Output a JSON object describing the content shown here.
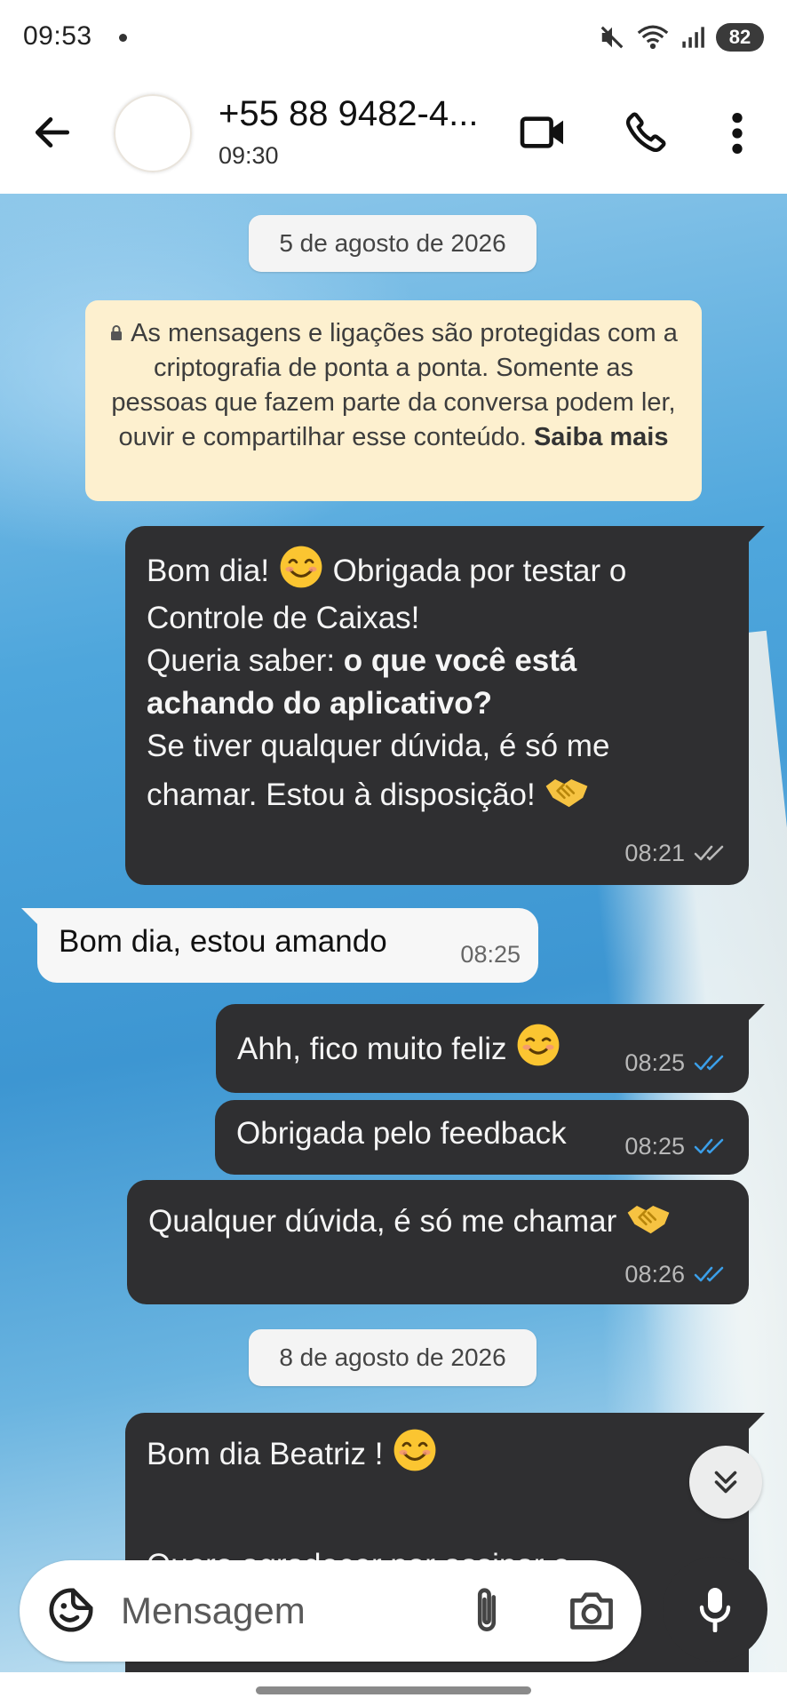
{
  "status_bar": {
    "time": "09:53",
    "battery": "82"
  },
  "header": {
    "contact_name": "+55 88 9482-4...",
    "last_seen": "09:30"
  },
  "chat": {
    "date_1": "5 de agosto de 2026",
    "encryption_notice": {
      "text": "As mensagens e ligações são protegidas com a criptografia de ponta a ponta. Somente as pessoas que fazem parte da conversa podem ler, ouvir e compartilhar esse conteúdo.",
      "link": "Saiba mais"
    },
    "messages": [
      {
        "direction": "out",
        "line1_a": "Bom dia!",
        "line1_b": "Obrigada por testar o",
        "line2": "Controle de Caixas!",
        "line3_a": "Queria saber: ",
        "line3_b": "o que você está",
        "line4": "achando do aplicativo?",
        "line5": "Se tiver qualquer dúvida, é só me",
        "line6": "chamar. Estou à disposição!",
        "time": "08:21",
        "status": "delivered"
      },
      {
        "direction": "in",
        "text": "Bom dia, estou amando",
        "time": "08:25"
      },
      {
        "direction": "out",
        "text": "Ahh, fico muito feliz",
        "time": "08:25",
        "status": "read"
      },
      {
        "direction": "out",
        "text": "Obrigada pelo feedback",
        "time": "08:25",
        "status": "read"
      },
      {
        "direction": "out",
        "text": "Qualquer dúvida, é só me chamar",
        "time": "08:26",
        "status": "read"
      },
      {
        "direction": "out",
        "line1": "Bom dia Beatriz !",
        "line2": "Quero agradecer por assinar o"
      }
    ],
    "date_2": "8 de agosto de 2026"
  },
  "composer": {
    "placeholder": "Mensagem"
  },
  "colors": {
    "bubble_out": "#2f2f31",
    "bubble_in": "#f7f7f7",
    "read_ticks": "#3b9ee8",
    "encryption_bg": "#fdf0cf"
  }
}
